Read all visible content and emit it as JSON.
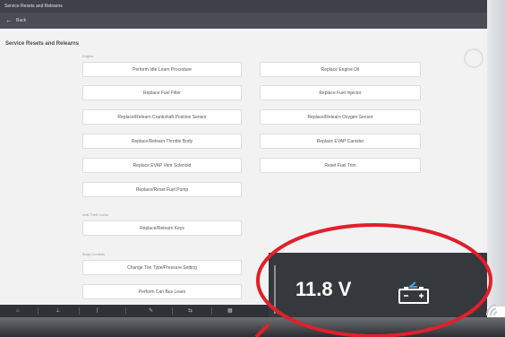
{
  "window": {
    "title": "Service Resets and Relearns"
  },
  "nav": {
    "back_label": "Back"
  },
  "page": {
    "title": "Service Resets and Relearns"
  },
  "sections": {
    "engine": "Engine",
    "anti_theft": "Anti-Theft Locks",
    "body": "Body Controls"
  },
  "buttons": {
    "idle_learn": "Perform Idle Learn Procedure",
    "engine_oil": "Replace Engine Oil",
    "fuel_filter": "Replace Fuel Filter",
    "fuel_injector": "Replace Fuel Injector",
    "crankshaft": "Replace/Relearn Crankshaft Position Sensor",
    "oxygen": "Replace/Relearn Oxygen Sensor",
    "throttle": "Replace/Relearn Throttle Body",
    "evap_canister": "Replace EVAP Canister",
    "evap_vent": "Replace EVAP Vent Solenoid",
    "fuel_trim": "Reset Fuel Trim",
    "fuel_pump": "Replace/Reset Fuel Pump",
    "keys": "Replace/Relearn Keys",
    "tire": "Change Tire Type/Pressure Setting",
    "can_bus": "Perform Can Bus Learn"
  },
  "status": {
    "voltage": "11.8 V"
  },
  "icons": {
    "back": "arrow-left-icon",
    "battery": "battery-icon",
    "logo": "wifi-corner-icon"
  },
  "colors": {
    "highlight": "#e0202a",
    "battery_accent": "#4aa3e0"
  }
}
